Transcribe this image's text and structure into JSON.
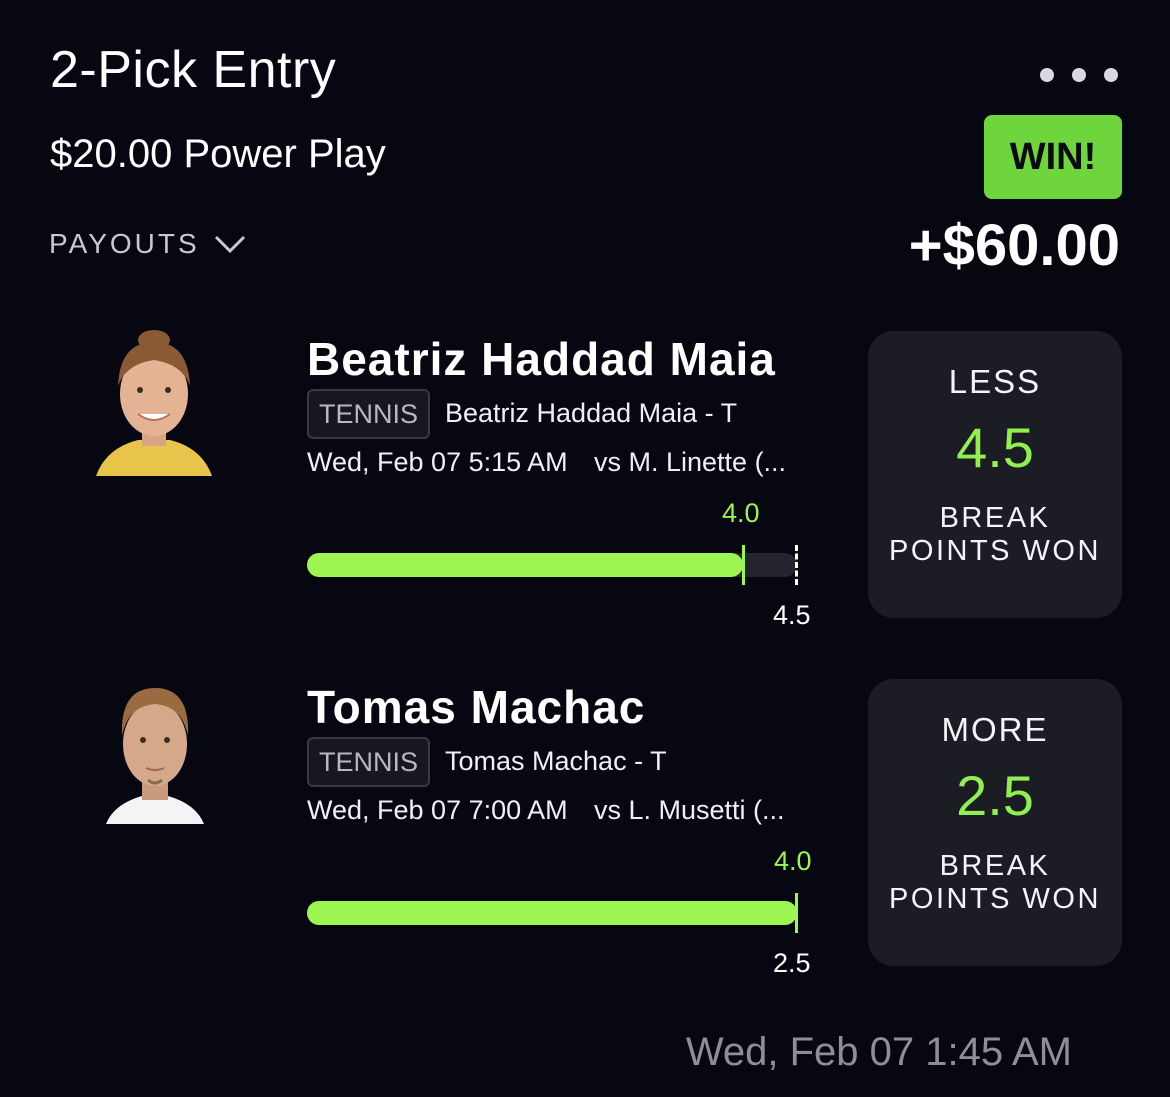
{
  "entry": {
    "title": "2-Pick Entry",
    "subtitle": "$20.00 Power Play",
    "result_badge": "WIN!",
    "payout_amount": "+$60.00",
    "payouts_label": "PAYOUTS",
    "timestamp": "Wed, Feb 07 1:45 AM",
    "more_icon": "more-horizontal-icon",
    "chevron_icon": "chevron-down-icon"
  },
  "picks": [
    {
      "name": "Beatriz Haddad Maia",
      "sport": "TENNIS",
      "description": "Beatriz Haddad Maia - T",
      "time": "Wed, Feb 07 5:15 AM",
      "opponent": "vs M. Linette (...",
      "actual": "4.0",
      "line": "4.5",
      "progress_fraction": 0.889,
      "direction": "LESS",
      "stat_line1": "BREAK",
      "stat_line2": "POINTS WON"
    },
    {
      "name": "Tomas Machac",
      "sport": "TENNIS",
      "description": "Tomas Machac - T",
      "time": "Wed, Feb 07 7:00 AM",
      "opponent": "vs L. Musetti (...",
      "actual": "4.0",
      "line": "2.5",
      "progress_fraction": 1.0,
      "direction": "MORE",
      "stat_line1": "BREAK",
      "stat_line2": "POINTS WON"
    }
  ],
  "colors": {
    "background": "#070712",
    "win_green": "#6ed63c",
    "progress_green": "#9cf550",
    "card_bg": "#1c1c24"
  }
}
